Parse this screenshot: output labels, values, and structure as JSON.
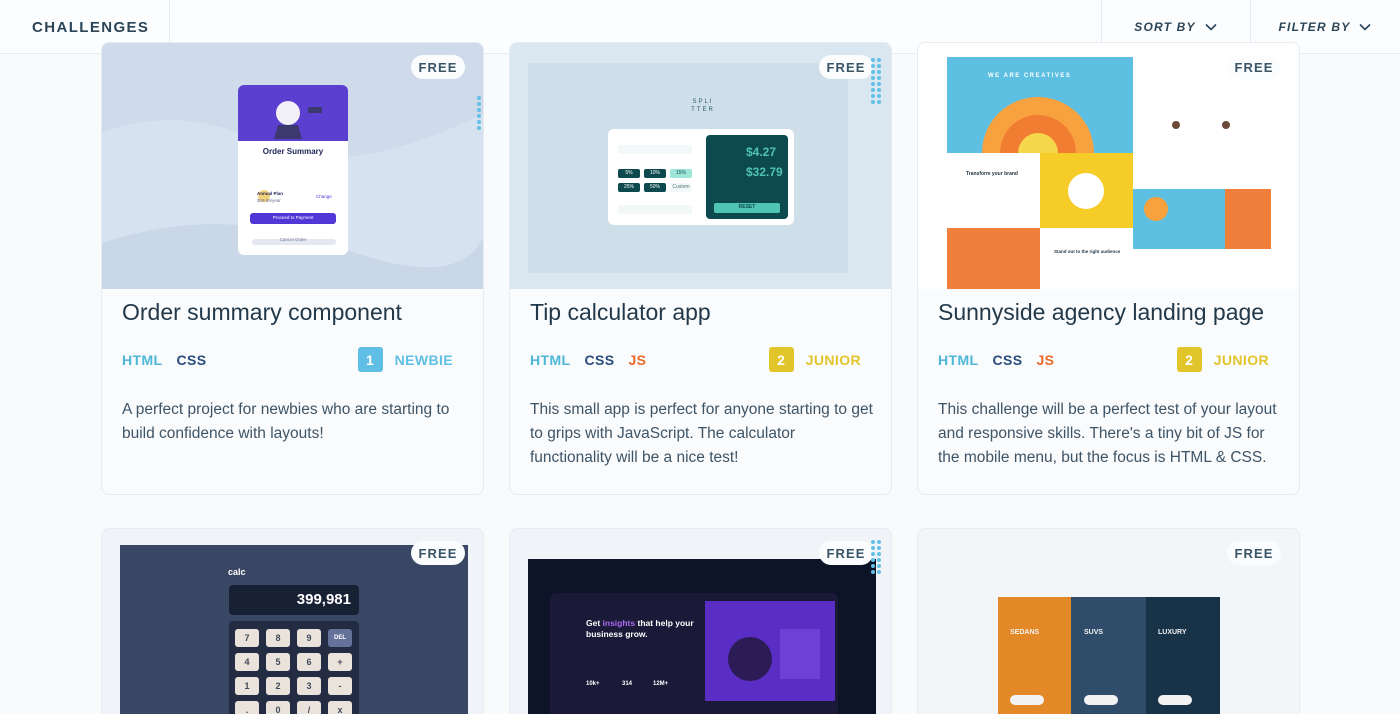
{
  "header": {
    "title": "CHALLENGES",
    "sort_label": "SORT BY",
    "filter_label": "FILTER BY"
  },
  "cards": [
    {
      "badge": "FREE",
      "title": "Order summary component",
      "tags": [
        "HTML",
        "CSS"
      ],
      "level_num": "1",
      "level_label": "NEWBIE",
      "level_color": "#5fbfe4",
      "description": "A perfect project for newbies who are starting to build confidence with layouts!",
      "preview": {
        "heading": "Order Summary",
        "plan": "Annual Plan",
        "price": "$59.99/year",
        "change": "Change",
        "cta": "Proceed to Payment",
        "cancel": "Cancel Order"
      }
    },
    {
      "badge": "FREE",
      "title": "Tip calculator app",
      "tags": [
        "HTML",
        "CSS",
        "JS"
      ],
      "level_num": "2",
      "level_label": "JUNIOR",
      "level_color": "#e2c42b",
      "description": "This small app is perfect for anyone starting to get to grips with JavaScript. The calculator functionality will be a nice test!",
      "preview": {
        "logo": "SPLI TTER",
        "tip": "$4.27",
        "total": "$32.79",
        "pcts": [
          "5%",
          "10%",
          "15%",
          "25%",
          "50%",
          "Custom"
        ],
        "reset": "RESET"
      }
    },
    {
      "badge": "FREE",
      "title": "Sunnyside agency landing page",
      "tags": [
        "HTML",
        "CSS",
        "JS"
      ],
      "level_num": "2",
      "level_label": "JUNIOR",
      "level_color": "#e2c42b",
      "description": "This challenge will be a perfect test of your layout and responsive skills. There's a tiny bit of JS for the mobile menu, but the focus is HTML & CSS.",
      "preview": {
        "hero": "WE ARE CREATIVES",
        "brand": "Transform your brand",
        "standout": "Stand out to the right audience"
      }
    },
    {
      "badge": "FREE",
      "preview": {
        "logo": "calc",
        "display": "399,981",
        "keys": [
          "7",
          "8",
          "9",
          "DEL",
          "4",
          "5",
          "6",
          "+",
          "1",
          "2",
          "3",
          "-",
          ".",
          "0",
          "/",
          "x"
        ]
      }
    },
    {
      "badge": "FREE",
      "preview": {
        "headline_a": "Get ",
        "headline_b": "insights",
        "headline_c": " that help your business grow.",
        "stats": [
          "10k+",
          "314",
          "12M+"
        ]
      }
    },
    {
      "badge": "FREE",
      "preview": {
        "cols": [
          "SEDANS",
          "SUVS",
          "LUXURY"
        ]
      }
    }
  ],
  "colors": {
    "html": "#4db6d9",
    "css": "#2a4c7c",
    "js": "#e76a2a"
  }
}
